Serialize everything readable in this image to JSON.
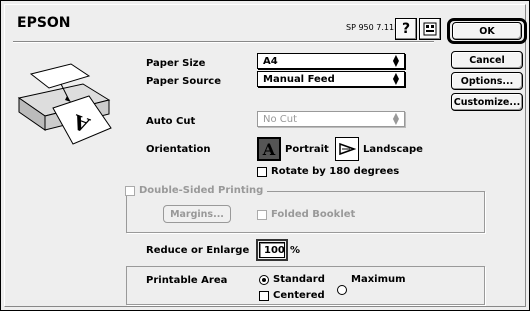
{
  "header": {
    "brand": "EPSON",
    "version": "SP 950 7.11E",
    "help_glyph": "?",
    "utility_glyph": "⌨"
  },
  "buttons": {
    "ok": "OK",
    "cancel": "Cancel",
    "options": "Options...",
    "customize": "Customize..."
  },
  "paper_size": {
    "label": "Paper Size",
    "value": "A4"
  },
  "paper_source": {
    "label": "Paper Source",
    "value": "Manual Feed"
  },
  "auto_cut": {
    "label": "Auto Cut",
    "value": "No Cut"
  },
  "orientation": {
    "label": "Orientation",
    "portrait": "Portrait",
    "landscape": "Landscape",
    "selected": "portrait",
    "rotate_label": "Rotate by 180 degrees"
  },
  "double_sided": {
    "label": "Double-Sided Printing",
    "margins_label": "Margins...",
    "folded_label": "Folded Booklet"
  },
  "reduce": {
    "label": "Reduce or Enlarge",
    "value": "100",
    "unit": "%"
  },
  "printable_area": {
    "label": "Printable Area",
    "standard": "Standard",
    "maximum": "Maximum",
    "selected": "standard",
    "centered_label": "Centered"
  }
}
